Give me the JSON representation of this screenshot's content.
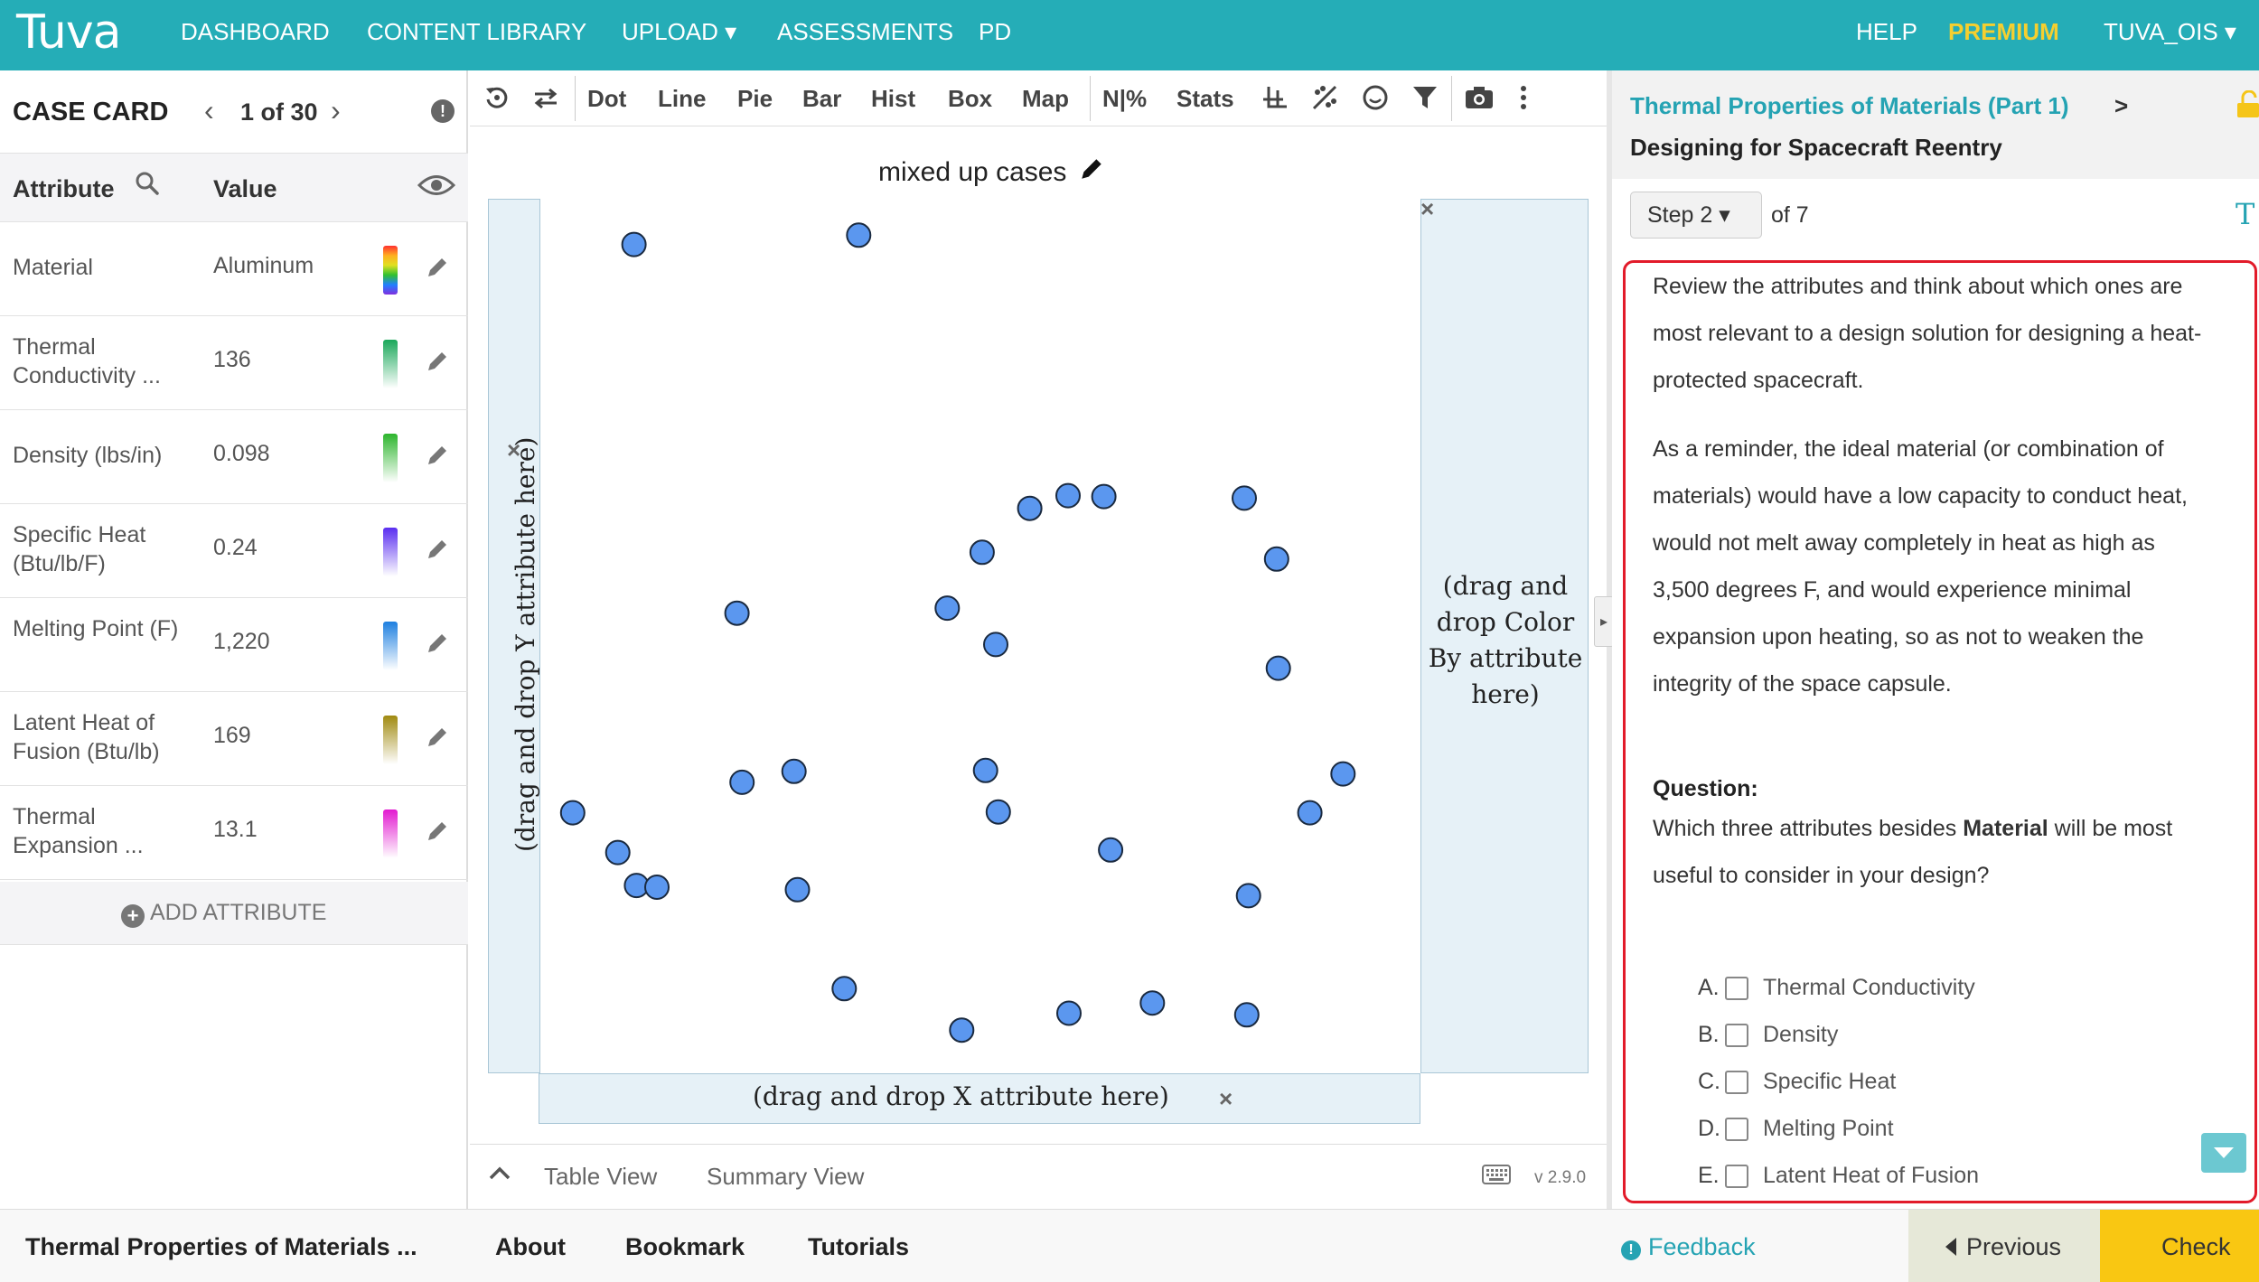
{
  "nav": {
    "logo_text": "Tuva",
    "items": [
      "DASHBOARD",
      "CONTENT LIBRARY",
      "UPLOAD ▾",
      "ASSESSMENTS",
      "PD"
    ],
    "help": "HELP",
    "premium": "PREMIUM",
    "user": "TUVA_OIS ▾"
  },
  "case_card": {
    "title": "CASE CARD",
    "pager": "1 of 30",
    "col_attribute": "Attribute",
    "col_value": "Value",
    "rows": [
      {
        "name": "Material",
        "value": "Aluminum",
        "swatch": "linear-gradient(#ff3030,#ffb020,#e0e020,#30c030,#2080ff,#8030e0)"
      },
      {
        "name": "Thermal Conductivity ...",
        "value": "136",
        "swatch": "linear-gradient(#1aa85a,#ffffff)"
      },
      {
        "name": "Density (lbs/in)",
        "value": "0.098",
        "swatch": "linear-gradient(#2db52d,#ffffff)"
      },
      {
        "name": "Specific Heat (Btu/lb/F)",
        "value": "0.24",
        "swatch": "linear-gradient(#5a2ef0,#ffffff)"
      },
      {
        "name": "Melting Point (F)",
        "value": "1,220",
        "swatch": "linear-gradient(#1e80e0,#ffffff)"
      },
      {
        "name": "Latent Heat of Fusion (Btu/lb)",
        "value": "169",
        "swatch": "linear-gradient(#a08a10,#ffffff)"
      },
      {
        "name": "Thermal Expansion ...",
        "value": "13.1",
        "swatch": "linear-gradient(#e21ad0,#ffffff)"
      }
    ],
    "add_attribute": "ADD ATTRIBUTE"
  },
  "toolbar": {
    "items": [
      "Dot",
      "Line",
      "Pie",
      "Bar",
      "Hist",
      "Box",
      "Map",
      "N|%",
      "Stats"
    ]
  },
  "graph": {
    "title": "mixed up cases",
    "y_drop": "(drag and drop Y attribute here)",
    "x_drop": "(drag and drop X attribute here)",
    "color_drop": "(drag and drop Color By attribute here)",
    "point_color": "#5b97ef"
  },
  "chart_data": {
    "type": "scatter",
    "xlabel": "",
    "ylabel": "",
    "xlim": [
      0,
      1
    ],
    "ylim": [
      0,
      1
    ],
    "note_values_are_fractions_of_plot": true,
    "points": [
      [
        0.093,
        0.963
      ],
      [
        0.357,
        0.974
      ],
      [
        0.214,
        0.527
      ],
      [
        0.461,
        0.533
      ],
      [
        0.518,
        0.49
      ],
      [
        0.502,
        0.599
      ],
      [
        0.558,
        0.651
      ],
      [
        0.603,
        0.666
      ],
      [
        0.645,
        0.665
      ],
      [
        0.81,
        0.663
      ],
      [
        0.848,
        0.591
      ],
      [
        0.85,
        0.462
      ],
      [
        0.021,
        0.291
      ],
      [
        0.074,
        0.244
      ],
      [
        0.096,
        0.205
      ],
      [
        0.12,
        0.203
      ],
      [
        0.22,
        0.327
      ],
      [
        0.281,
        0.34
      ],
      [
        0.506,
        0.341
      ],
      [
        0.521,
        0.292
      ],
      [
        0.285,
        0.2
      ],
      [
        0.653,
        0.247
      ],
      [
        0.887,
        0.291
      ],
      [
        0.926,
        0.337
      ],
      [
        0.815,
        0.193
      ],
      [
        0.34,
        0.083
      ],
      [
        0.478,
        0.034
      ],
      [
        0.604,
        0.054
      ],
      [
        0.702,
        0.066
      ],
      [
        0.813,
        0.052
      ]
    ]
  },
  "graph_bottom": {
    "table_view": "Table View",
    "summary_view": "Summary View",
    "version": "v 2.9.0"
  },
  "right_panel": {
    "link": "Thermal Properties of Materials (Part 1)",
    "subtitle": "Designing for Spacecraft Reentry",
    "step": "Step 2 ▾",
    "of": "of 7",
    "para1": "Review the attributes and think about which ones are most relevant to a design solution for designing a heat-protected spacecraft.",
    "para2": "As a reminder, the ideal material (or combination of materials) would have a low capacity to conduct heat, would not melt away completely in heat as high as 3,500 degrees F, and would experience minimal expansion upon heating, so as not to weaken the integrity of the space capsule.",
    "question_label": "Question:",
    "question_pre": "Which three attributes besides ",
    "question_bold": "Material",
    "question_post": " will be most useful to consider in your design?",
    "options": [
      {
        "letter": "A.",
        "text": "Thermal Conductivity"
      },
      {
        "letter": "B.",
        "text": "Density"
      },
      {
        "letter": "C.",
        "text": "Specific Heat"
      },
      {
        "letter": "D.",
        "text": "Melting Point"
      },
      {
        "letter": "E.",
        "text": "Latent Heat of Fusion"
      }
    ]
  },
  "footer": {
    "title": "Thermal Properties of Materials ...",
    "about": "About",
    "bookmark": "Bookmark",
    "tutorials": "Tutorials",
    "feedback": "Feedback",
    "previous": "Previous",
    "check": "Check"
  }
}
